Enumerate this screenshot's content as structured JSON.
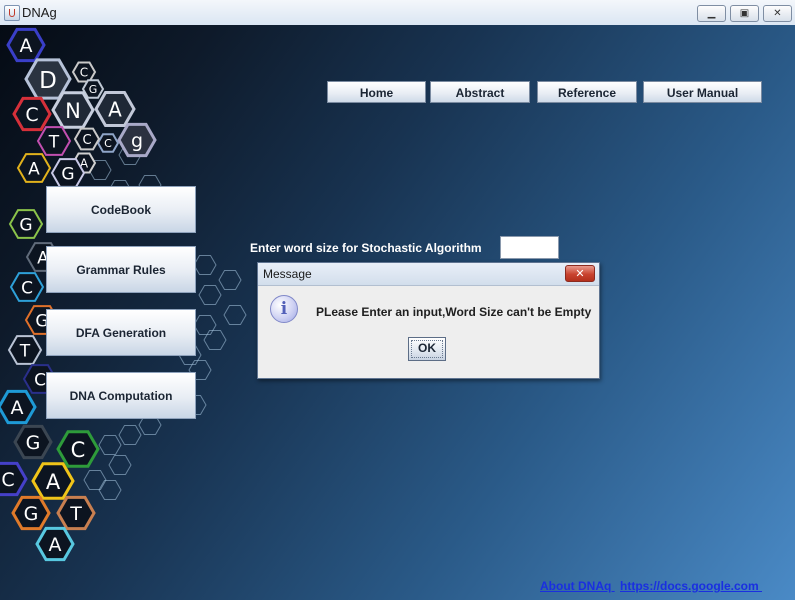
{
  "window": {
    "title": "DNAg",
    "controls": [
      "minimize",
      "maximize",
      "close"
    ]
  },
  "nav": {
    "items": [
      "Home",
      "Abstract",
      "Reference",
      "User Manual"
    ]
  },
  "sidebar": {
    "items": [
      "CodeBook",
      "Grammar Rules",
      "DFA Generation",
      "DNA Computation"
    ]
  },
  "form": {
    "label": "Enter word size for Stochastic Algorithm",
    "value": ""
  },
  "logo": {
    "hexagon_letters": [
      "A",
      "D",
      "C",
      "C",
      "G",
      "N",
      "A",
      "C",
      "T",
      "A",
      "C",
      "g",
      "A",
      "G",
      "G",
      "A",
      "C",
      "G",
      "T",
      "C",
      "A",
      "G",
      "C",
      "C",
      "A",
      "G",
      "T",
      "A"
    ]
  },
  "dialog": {
    "title": "Message",
    "message": "PLease Enter an input,Word Size can't be Empty",
    "ok_label": "OK",
    "icon": "info-icon"
  },
  "footer": {
    "about_link": "About DNAq ",
    "docs_link": "https://docs.google.com "
  },
  "colors": {
    "background_dark": "#050b14",
    "background_light": "#4a8ac6",
    "link": "#1a2fe0",
    "close_red": "#c9432f"
  }
}
